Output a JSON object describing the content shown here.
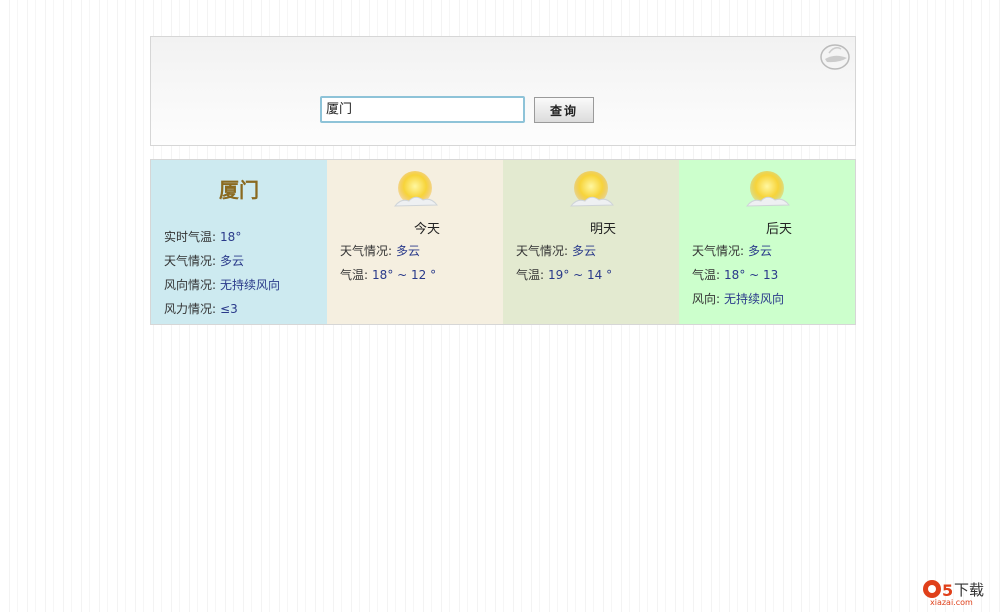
{
  "search": {
    "value": "厦门",
    "button": "查询"
  },
  "current": {
    "city": "厦门",
    "rows": [
      {
        "label": "实时气温:",
        "value": "18°"
      },
      {
        "label": "天气情况:",
        "value": "多云"
      },
      {
        "label": "风向情况:",
        "value": "无持续风向"
      },
      {
        "label": "风力情况:",
        "value": "≤3"
      }
    ]
  },
  "forecast": [
    {
      "day": "今天",
      "icon": "partly-cloudy-icon",
      "rows": [
        {
          "label": "天气情况:",
          "value": "多云"
        },
        {
          "label": "气温:",
          "value": "18° ~ 12 °"
        }
      ]
    },
    {
      "day": "明天",
      "icon": "partly-cloudy-icon",
      "rows": [
        {
          "label": "天气情况:",
          "value": "多云"
        },
        {
          "label": "气温:",
          "value": "19° ~ 14 °"
        }
      ]
    },
    {
      "day": "后天",
      "icon": "partly-cloudy-icon",
      "rows": [
        {
          "label": "天气情况:",
          "value": "多云"
        },
        {
          "label": "气温:",
          "value": "18° ~ 13"
        },
        {
          "label": "风向:",
          "value": "无持续风向"
        }
      ]
    }
  ],
  "watermark": {
    "text": "a5下载 xiazai.com"
  }
}
